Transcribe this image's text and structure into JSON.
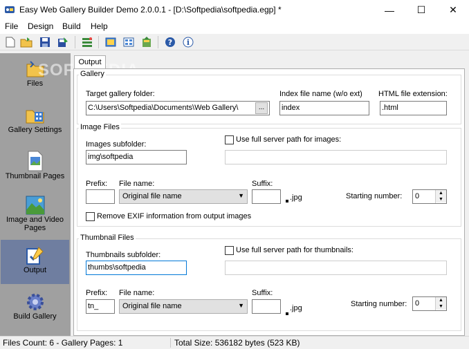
{
  "window": {
    "title": "Easy Web Gallery Builder Demo 2.0.0.1 - [D:\\Softpedia\\softpedia.egp] *",
    "minimize_glyph": "—",
    "maximize_glyph": "☐",
    "close_glyph": "✕"
  },
  "menu": [
    "File",
    "Design",
    "Build",
    "Help"
  ],
  "toolbar": {
    "icons": [
      "new-icon",
      "open-icon",
      "save-icon",
      "save-as-icon",
      "build-icon",
      "preview-icon",
      "gallery-icon",
      "upload-icon",
      "help-icon",
      "about-icon"
    ]
  },
  "watermark": "SOFTPEDIA",
  "sidebar": {
    "items": [
      {
        "label": "Files",
        "icon": "folder-icon",
        "active": false
      },
      {
        "label": "Gallery Settings",
        "icon": "gallery-settings-icon",
        "active": false
      },
      {
        "label": "Thumbnail Pages",
        "icon": "thumbnail-pages-icon",
        "active": false
      },
      {
        "label": "Image and Video Pages",
        "icon": "image-pages-icon",
        "active": false
      },
      {
        "label": "Output",
        "icon": "output-icon",
        "active": true
      },
      {
        "label": "Build Gallery",
        "icon": "gear-icon",
        "active": false
      }
    ]
  },
  "tab": {
    "label": "Output"
  },
  "gallery_group": {
    "title": "Gallery",
    "target_label": "Target gallery folder:",
    "target_value": "C:\\Users\\Softpedia\\Documents\\Web Gallery\\",
    "browse_label": "...",
    "index_label": "Index file name (w/o ext)",
    "index_value": "index",
    "html_ext_label": "HTML file extension:",
    "html_ext_value": ".html"
  },
  "image_group": {
    "title": "Image Files",
    "subfolder_label": "Images subfolder:",
    "subfolder_value": "img\\softpedia",
    "full_path_label": "Use full server path for images:",
    "full_path_value": "",
    "prefix_label": "Prefix:",
    "prefix_value": "",
    "filename_label": "File name:",
    "filename_value": "Original file name",
    "suffix_label": "Suffix:",
    "suffix_value": "",
    "ext": ".jpg",
    "starting_label": "Starting number:",
    "starting_value": "0",
    "exif_label": "Remove EXIF information from output images"
  },
  "thumb_group": {
    "title": "Thumbnail Files",
    "subfolder_label": "Thumbnails subfolder:",
    "subfolder_value": "thumbs\\softpedia",
    "full_path_label": "Use full server path for thumbnails:",
    "full_path_value": "",
    "prefix_label": "Prefix:",
    "prefix_value": "tn_",
    "filename_label": "File name:",
    "filename_value": "Original file name",
    "suffix_label": "Suffix:",
    "suffix_value": "",
    "ext": ".jpg",
    "starting_label": "Starting number:",
    "starting_value": "0"
  },
  "status": {
    "files_count": "Files Count: 6 - Gallery Pages: 1",
    "total_size": "Total Size: 536182 bytes (523 KB)"
  },
  "colors": {
    "sidebar_bg": "#a0a0a0",
    "sidebar_active": "#6f7ea0",
    "focus_border": "#0078d7"
  }
}
